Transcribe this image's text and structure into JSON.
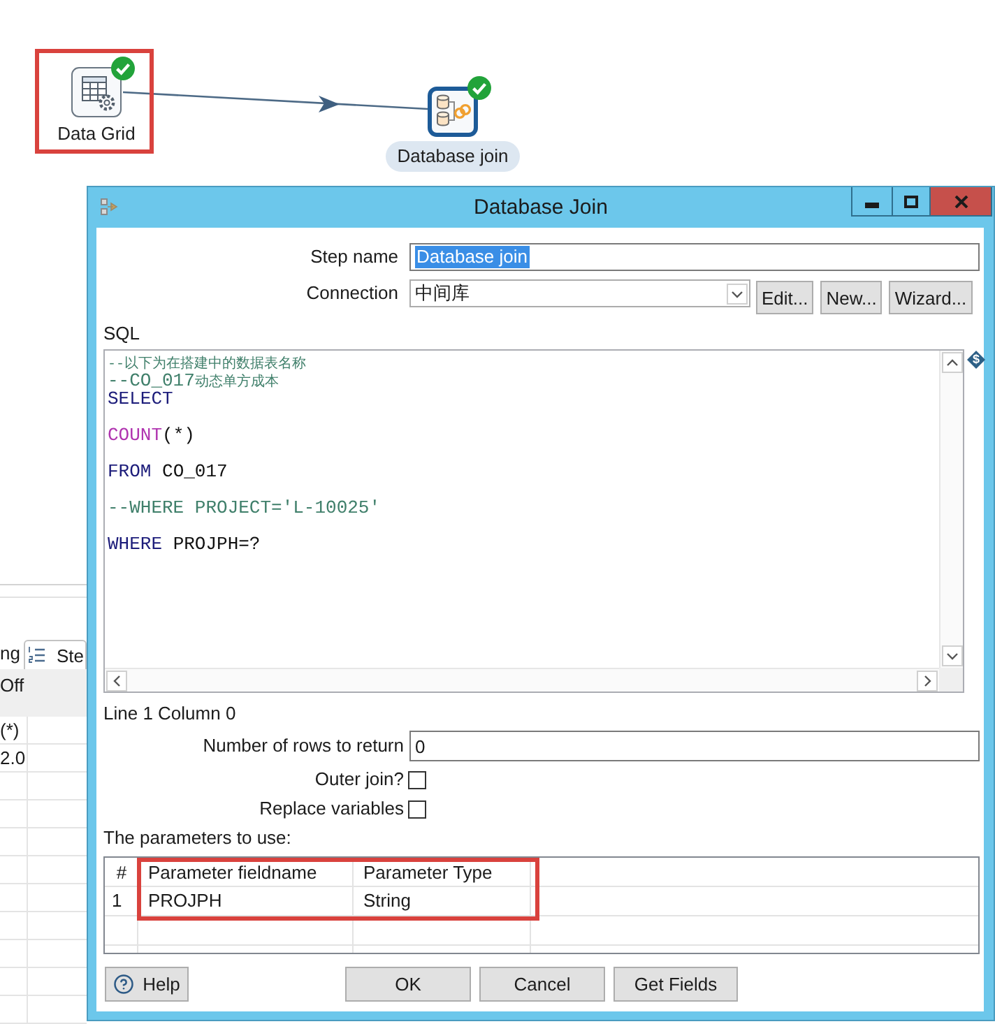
{
  "canvas": {
    "steps": [
      {
        "label": "Data Grid",
        "kind": "grid",
        "selected": false,
        "valid": true,
        "highlighted": true
      },
      {
        "label": "Database join",
        "kind": "join",
        "selected": true,
        "valid": true,
        "highlighted": false
      }
    ]
  },
  "background_panel": {
    "tabs": [
      {
        "label": "ng",
        "kind": "plain"
      },
      {
        "label": "Ste",
        "kind": "steps"
      }
    ],
    "header": "Off",
    "cells": [
      "(*)",
      "2.0"
    ]
  },
  "dialog": {
    "title": "Database Join",
    "step_name": {
      "label": "Step name",
      "value": "Database join",
      "selected": true
    },
    "connection": {
      "label": "Connection",
      "value": "中间库",
      "buttons": [
        "Edit...",
        "New...",
        "Wizard..."
      ]
    },
    "sql": {
      "label": "SQL",
      "variable_marker": "$",
      "lines": [
        {
          "kind": "code",
          "tokens": [
            {
              "kind": "note",
              "text": "--以下为在搭建中的数据表名称"
            }
          ]
        },
        {
          "kind": "code",
          "tokens": [
            {
              "kind": "comment",
              "text": "--CO_017"
            },
            {
              "kind": "note",
              "text": "动态单方成本"
            }
          ]
        },
        {
          "kind": "code",
          "tokens": [
            {
              "kind": "keyword",
              "text": "SELECT"
            }
          ]
        },
        {
          "kind": "blank"
        },
        {
          "kind": "code",
          "tokens": [
            {
              "kind": "function",
              "text": "COUNT"
            },
            {
              "kind": "plain",
              "text": "(*)"
            }
          ]
        },
        {
          "kind": "blank"
        },
        {
          "kind": "code",
          "tokens": [
            {
              "kind": "keyword",
              "text": "FROM"
            },
            {
              "kind": "plain",
              "text": " CO_017"
            }
          ]
        },
        {
          "kind": "blank"
        },
        {
          "kind": "code",
          "tokens": [
            {
              "kind": "comment",
              "text": "--WHERE PROJECT='L-10025'"
            }
          ]
        },
        {
          "kind": "blank"
        },
        {
          "kind": "code",
          "tokens": [
            {
              "kind": "keyword",
              "text": "WHERE"
            },
            {
              "kind": "plain",
              "text": " PROJPH=?"
            }
          ]
        }
      ]
    },
    "cursor_status": "Line 1 Column 0",
    "rows_to_return": {
      "label": "Number of rows to return",
      "value": "0"
    },
    "options": [
      {
        "label": "Outer join?",
        "checked": false
      },
      {
        "label": "Replace variables",
        "checked": false
      }
    ],
    "parameters": {
      "label": "The parameters to use:",
      "highlighted": true,
      "columns": [
        "#",
        "Parameter fieldname",
        "Parameter Type"
      ],
      "rows": [
        {
          "number": "1",
          "fieldname": "PROJPH",
          "type": "String"
        }
      ]
    },
    "buttons": [
      {
        "label": "Help",
        "kind": "help"
      },
      {
        "label": "OK",
        "kind": "plain"
      },
      {
        "label": "Cancel",
        "kind": "plain"
      },
      {
        "label": "Get Fields",
        "kind": "plain"
      }
    ]
  }
}
